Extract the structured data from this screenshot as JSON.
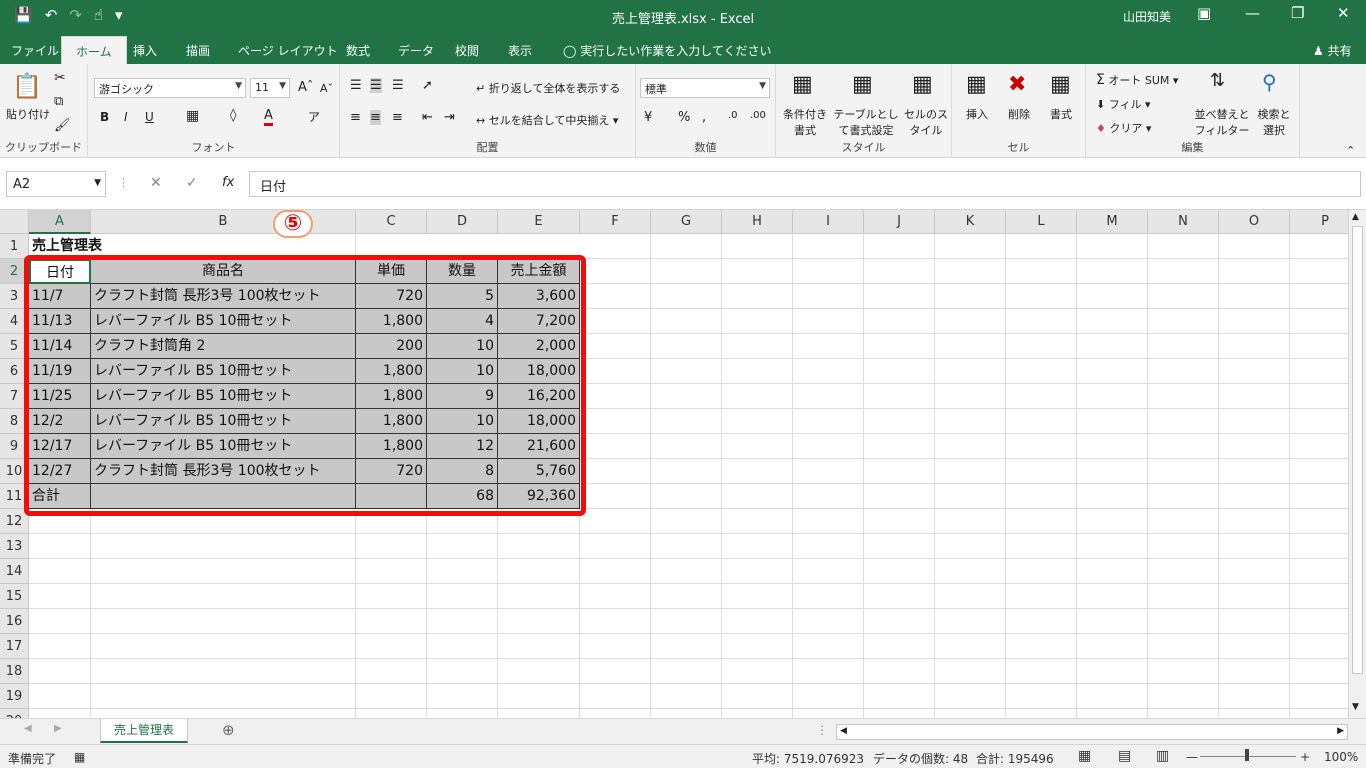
{
  "window": {
    "title": "売上管理表.xlsx  -  Excel",
    "user": "山田知美"
  },
  "ribbon_tabs": [
    "ファイル",
    "ホーム",
    "挿入",
    "描画",
    "ページ レイアウト",
    "数式",
    "データ",
    "校閲",
    "表示"
  ],
  "tellme": "実行したい作業を入力してください",
  "share": "共有",
  "ribbon": {
    "clipboard": {
      "paste": "貼り付け",
      "label": "クリップボード"
    },
    "font": {
      "name": "游ゴシック",
      "size": "11",
      "label": "フォント"
    },
    "align": {
      "wrap": "折り返して全体を表示する",
      "merge": "セルを結合して中央揃え",
      "label": "配置"
    },
    "number": {
      "format": "標準",
      "label": "数値"
    },
    "styles": {
      "cond": "条件付き書式",
      "table": "テーブルとして書式設定",
      "cell": "セルのスタイル",
      "label": "スタイル"
    },
    "cells": {
      "insert": "挿入",
      "delete": "削除",
      "format": "書式",
      "label": "セル"
    },
    "edit": {
      "autosum": "オート SUM",
      "fill": "フィル",
      "clear": "クリア",
      "sort": "並べ替えとフィルター",
      "find": "検索と選択",
      "label": "編集"
    }
  },
  "formula_bar": {
    "name_box": "A2",
    "content": "日付"
  },
  "columns": [
    "A",
    "B",
    "C",
    "D",
    "E",
    "F",
    "G",
    "H",
    "I",
    "J",
    "K",
    "L",
    "M",
    "N",
    "O",
    "P"
  ],
  "rows": [
    "1",
    "2",
    "3",
    "4",
    "5",
    "6",
    "7",
    "8",
    "9",
    "10",
    "11",
    "12",
    "13",
    "14",
    "15",
    "16",
    "17",
    "18",
    "19",
    "20"
  ],
  "sheet": {
    "title": "売上管理表",
    "headers": [
      "日付",
      "商品名",
      "単価",
      "数量",
      "売上金額"
    ],
    "data": [
      [
        "11/7",
        "クラフト封筒 長形3号 100枚セット",
        "720",
        "5",
        "3,600"
      ],
      [
        "11/13",
        "レバーファイル B5 10冊セット",
        "1,800",
        "4",
        "7,200"
      ],
      [
        "11/14",
        "クラフト封筒角 2",
        "200",
        "10",
        "2,000"
      ],
      [
        "11/19",
        "レバーファイル B5 10冊セット",
        "1,800",
        "10",
        "18,000"
      ],
      [
        "11/25",
        "レバーファイル B5 10冊セット",
        "1,800",
        "9",
        "16,200"
      ],
      [
        "12/2",
        "レバーファイル B5 10冊セット",
        "1,800",
        "10",
        "18,000"
      ],
      [
        "12/17",
        "レバーファイル B5 10冊セット",
        "1,800",
        "12",
        "21,600"
      ],
      [
        "12/27",
        "クラフト封筒 長形3号 100枚セット",
        "720",
        "8",
        "5,760"
      ]
    ],
    "total": [
      "合計",
      "",
      "",
      "68",
      "92,360"
    ]
  },
  "annotation": "⑤",
  "sheet_tab": "売上管理表",
  "status": {
    "ready": "準備完了",
    "average": "平均: 7519.076923",
    "count": "データの個数: 48",
    "sum": "合計: 195496",
    "zoom": "100%"
  }
}
